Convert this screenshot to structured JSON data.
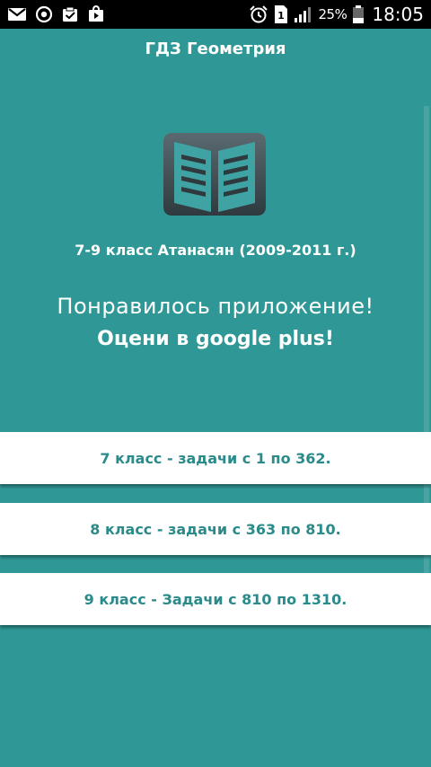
{
  "status_bar": {
    "icons_left": [
      "gmail-icon",
      "sync-icon",
      "clipboard-check-icon",
      "shopping-bag-icon"
    ],
    "icons_right": [
      "alarm-icon",
      "sim-icon",
      "signal-icon",
      "battery-icon"
    ],
    "battery_percent": "25%",
    "time": "18:05"
  },
  "app": {
    "title": "ГДЗ Геометрия"
  },
  "main": {
    "book_icon": "open-book-icon",
    "edition": "7-9 класс Атанасян (2009-2011 г.)",
    "rate_line1": "Понравилось приложение!",
    "rate_line2": "Оцени в google plus!"
  },
  "grades": [
    {
      "label": "7 класс - задачи с 1 по 362."
    },
    {
      "label": "8 класс - задачи с 363 по 810."
    },
    {
      "label": "9 класс - Задачи с 810 по 1310."
    }
  ],
  "colors": {
    "background": "#2f9896",
    "button_text": "#2b8a8a",
    "button_bg": "#ffffff"
  }
}
